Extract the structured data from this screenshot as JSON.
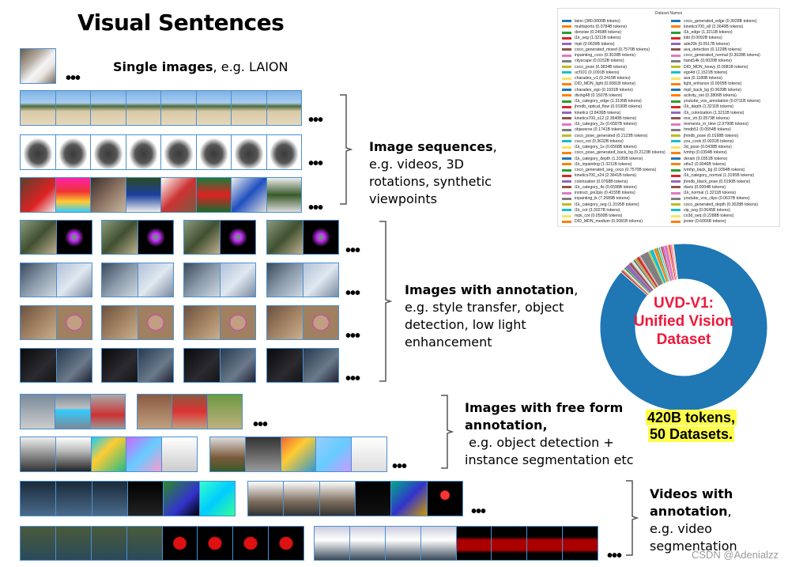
{
  "title": "Visual Sentences",
  "sections": {
    "single": {
      "bold": "Single images",
      "rest": ", e.g. LAION"
    },
    "sequences": {
      "bold": "Image sequences",
      "lines": [
        ",",
        "e.g. videos, 3D",
        "rotations, synthetic",
        "viewpoints"
      ]
    },
    "annotation": {
      "bold": "Images with annotation",
      "lines": [
        ",",
        "e.g. style transfer, object",
        "detection, low light",
        "enhancement"
      ]
    },
    "freeform": {
      "bold": "Images with free form",
      "lines": [
        "annotation,",
        " e.g. object detection +",
        "instance segmentation etc"
      ]
    },
    "videos": {
      "bold": "Videos with",
      "lines": [
        "annotation",
        ",",
        "e.g. video",
        "segmentation"
      ]
    }
  },
  "ellipsis": "•••",
  "donut": {
    "label_lines": [
      "UVD-V1:",
      "Unified Vision",
      "Dataset"
    ],
    "stats_lines": [
      "420B tokens,",
      "50 Datasets."
    ],
    "label_color": "#f0173a",
    "highlight_color": "#fdfd4a"
  },
  "legend": {
    "title": "Dataset Names",
    "palette": [
      "#1f77b4",
      "#ff7f0e",
      "#2ca02c",
      "#d62728",
      "#9467bd",
      "#8c564b",
      "#e377c2",
      "#7f7f7f",
      "#bcbd22",
      "#17becf",
      "#f7e463",
      "#ff7f0e"
    ],
    "items": [
      {
        "label": "laion (380.0000B tokens)",
        "value": 380.0
      },
      {
        "label": "multisports (0.0784B tokens)",
        "value": 0.0784
      },
      {
        "label": "denoise (0.2458B tokens)",
        "value": 0.2458
      },
      {
        "label": "i1k_seg (1.3211B tokens)",
        "value": 1.3211
      },
      {
        "label": "mpii (0.0639B tokens)",
        "value": 0.0639
      },
      {
        "label": "coco_generated_mixed (0.7570B tokens)",
        "value": 0.757
      },
      {
        "label": "inpainting_coco (0.3028B tokens)",
        "value": 0.3028
      },
      {
        "label": "cityscape (0.0152B tokens)",
        "value": 0.0152
      },
      {
        "label": "coco_pose (0.3834B tokens)",
        "value": 0.3834
      },
      {
        "label": "ucf101 (0.1091B tokens)",
        "value": 0.1091
      },
      {
        "label": "charades_v1 (0.2415B tokens)",
        "value": 0.2415
      },
      {
        "label": "DID_MDN_light (0.0081B tokens)",
        "value": 0.0081
      },
      {
        "label": "charades_ego (0.1931B tokens)",
        "value": 0.1931
      },
      {
        "label": "diving48 (0.1507B tokens)",
        "value": 0.1507
      },
      {
        "label": "i1k_category_edge (1.3195B tokens)",
        "value": 1.3195
      },
      {
        "label": "jhmdb_optical_flow (0.0190B tokens)",
        "value": 0.019
      },
      {
        "label": "kinetics (3.8436B tokens)",
        "value": 3.8436
      },
      {
        "label": "kinetics700_s12 (2.3640B tokens)",
        "value": 2.364
      },
      {
        "label": "i1k_category_2s (0.6587B tokens)",
        "value": 0.6587
      },
      {
        "label": "objaverse (0.1741B tokens)",
        "value": 0.1741
      },
      {
        "label": "coco_pose_generated (0.2123B tokens)",
        "value": 0.2123
      },
      {
        "label": "coco_cot (0.3632B tokens)",
        "value": 0.3632
      },
      {
        "label": "i1k_category_1s (0.6568B tokens)",
        "value": 0.6568
      },
      {
        "label": "coco_pose_generated_back_bg (0.2123B tokens)",
        "value": 0.2123
      },
      {
        "label": "i1k_category_depth (1.3195B tokens)",
        "value": 1.3195
      },
      {
        "label": "i1k_inpainting (1.3211B tokens)",
        "value": 1.3211
      },
      {
        "label": "coco_generated_seg_coco (0.7570B tokens)",
        "value": 0.757
      },
      {
        "label": "kinetics700_s24 (2.3641B tokens)",
        "value": 2.3641
      },
      {
        "label": "colorization (0.0768B tokens)",
        "value": 0.0768
      },
      {
        "label": "i1k_category_4s (0.6598B tokens)",
        "value": 0.6598
      },
      {
        "label": "instruct_pix2pix (0.4155B tokens)",
        "value": 0.4155
      },
      {
        "label": "inpainting_ik (7.2689B tokens)",
        "value": 7.2689
      },
      {
        "label": "i1k_category_seg (1.3195B tokens)",
        "value": 1.3195
      },
      {
        "label": "i1k_cot (3.3027B tokens)",
        "value": 3.3027
      },
      {
        "label": "mpii_cot (0.0500B tokens)",
        "value": 0.05
      },
      {
        "label": "DID_MDN_medium (0.0081B tokens)",
        "value": 0.0081
      },
      {
        "label": "coco_generated_edge (0.3028B tokens)",
        "value": 0.3028
      },
      {
        "label": "kinetics700_s8 (2.3640B tokens)",
        "value": 2.364
      },
      {
        "label": "i1k_edge (1.3211B tokens)",
        "value": 1.3211
      },
      {
        "label": "kitti (0.0092B tokens)",
        "value": 0.0092
      },
      {
        "label": "ade20k (0.0517B tokens)",
        "value": 0.0517
      },
      {
        "label": "ava_detection (0.1229B tokens)",
        "value": 0.1229
      },
      {
        "label": "coco_generated_normal (0.3028B tokens)",
        "value": 0.3028
      },
      {
        "label": "hand14k (0.0020B tokens)",
        "value": 0.002
      },
      {
        "label": "DID_MDN_heavy (0.0081B tokens)",
        "value": 0.0081
      },
      {
        "label": "ego4d (1.1521B tokens)",
        "value": 1.1521
      },
      {
        "label": "ava (0.1180B tokens)",
        "value": 0.118
      },
      {
        "label": "light_enhance (0.0005B tokens)",
        "value": 0.0005
      },
      {
        "label": "mpii_back_bg (0.0639B tokens)",
        "value": 0.0639
      },
      {
        "label": "activity_net (0.3806B tokens)",
        "value": 0.3806
      },
      {
        "label": "youtube_vos_annotation (0.0711B tokens)",
        "value": 0.0711
      },
      {
        "label": "i1k_depth (1.3211B tokens)",
        "value": 1.3211
      },
      {
        "label": "i1k_colorization (1.3211B tokens)",
        "value": 1.3211
      },
      {
        "label": "msr_vtt (0.0573B tokens)",
        "value": 0.0573
      },
      {
        "label": "moments_in_time (2.9790B tokens)",
        "value": 2.979
      },
      {
        "label": "hmdb51 (0.0554B tokens)",
        "value": 0.0554
      },
      {
        "label": "jhmdb_pose (0.0198B tokens)",
        "value": 0.0198
      },
      {
        "label": "you_cook (0.0031B tokens)",
        "value": 0.0031
      },
      {
        "label": "3d_pose (0.0438B tokens)",
        "value": 0.0438
      },
      {
        "label": "lvmhp (0.0394B tokens)",
        "value": 0.0394
      },
      {
        "label": "derain (0.0351B tokens)",
        "value": 0.0351
      },
      {
        "label": "sthv2 (0.9046B tokens)",
        "value": 0.9046
      },
      {
        "label": "lvmhp_back_bg (0.0394B tokens)",
        "value": 0.0394
      },
      {
        "label": "i1k_category_normal (1.3195B tokens)",
        "value": 1.3195
      },
      {
        "label": "jhmdb_black_pose (0.0190B tokens)",
        "value": 0.019
      },
      {
        "label": "davis (0.0004B tokens)",
        "value": 0.0004
      },
      {
        "label": "i1k_normal (1.3211B tokens)",
        "value": 1.3211
      },
      {
        "label": "youtube_vos_clips (0.0637B tokens)",
        "value": 0.0637
      },
      {
        "label": "coco_generated_depth (0.3028B tokens)",
        "value": 0.3028
      },
      {
        "label": "vip_seg (0.0645B tokens)",
        "value": 0.0645
      },
      {
        "label": "co3d_seq (0.2288B tokens)",
        "value": 0.2288
      },
      {
        "label": "jester (0.6065B tokens)",
        "value": 0.6065
      }
    ]
  },
  "watermark": "CSDN @Adenialzz"
}
